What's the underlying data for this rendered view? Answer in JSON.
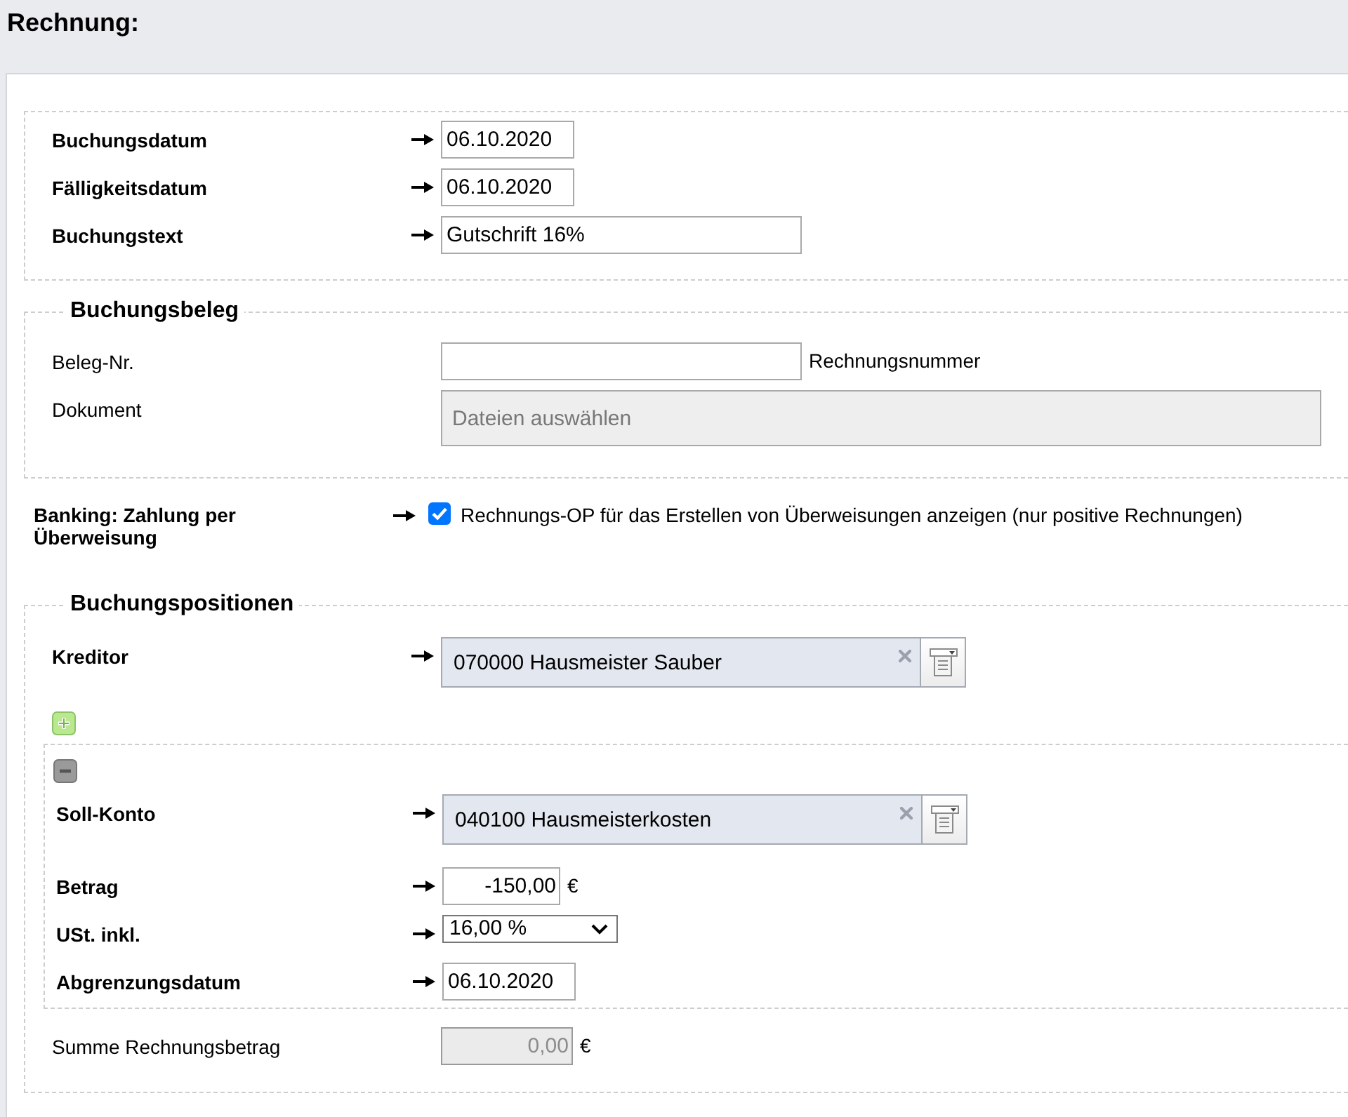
{
  "title": "Rechnung:",
  "general": {
    "fields": [
      {
        "kind": "date",
        "label": "Buchungsdatum",
        "required": true,
        "value": "06.10.2020"
      },
      {
        "kind": "date",
        "label": "Fälligkeitsdatum",
        "required": true,
        "value": "06.10.2020"
      },
      {
        "kind": "text",
        "label": "Buchungstext",
        "required": true,
        "value": "Gutschrift 16%"
      }
    ]
  },
  "buchungsbeleg": {
    "legend": "Buchungsbeleg",
    "fields": [
      {
        "kind": "text",
        "label": "Beleg-Nr.",
        "required": false,
        "note": "Rechnungsnummer"
      },
      {
        "kind": "file",
        "label": "Dokument",
        "required": false,
        "placeholder": "Dateien auswählen"
      }
    ]
  },
  "banking": {
    "label": "Banking: Zahlung per Überweisung",
    "required": true,
    "checkbox": {
      "label": "Rechnungs-OP für das Erstellen von Überweisungen anzeigen (nur positive Rechnungen)",
      "checked": true
    }
  },
  "buchungspositionen": {
    "legend": "Buchungspositionen",
    "fields": [
      {
        "kind": "lookup",
        "label": "Kreditor",
        "required": true,
        "value": "070000 Hausmeister Sauber"
      }
    ],
    "positions": [
      {
        "fields": [
          {
            "kind": "lookup",
            "label": "Soll-Konto",
            "required": true,
            "value": "040100 Hausmeisterkosten"
          },
          {
            "kind": "amount",
            "label": "Betrag",
            "required": true,
            "value": "-150,00",
            "unit": "€",
            "disabled": false
          },
          {
            "kind": "select",
            "label": "USt. inkl.",
            "required": true,
            "value": "16,00 %"
          },
          {
            "kind": "date",
            "label": "Abgrenzungsdatum",
            "required": true,
            "value": "06.10.2020"
          }
        ]
      }
    ],
    "total": {
      "kind": "amount",
      "label": "Summe Rechnungsbetrag",
      "required": false,
      "value": "0,00",
      "unit": "€",
      "disabled": true
    }
  }
}
